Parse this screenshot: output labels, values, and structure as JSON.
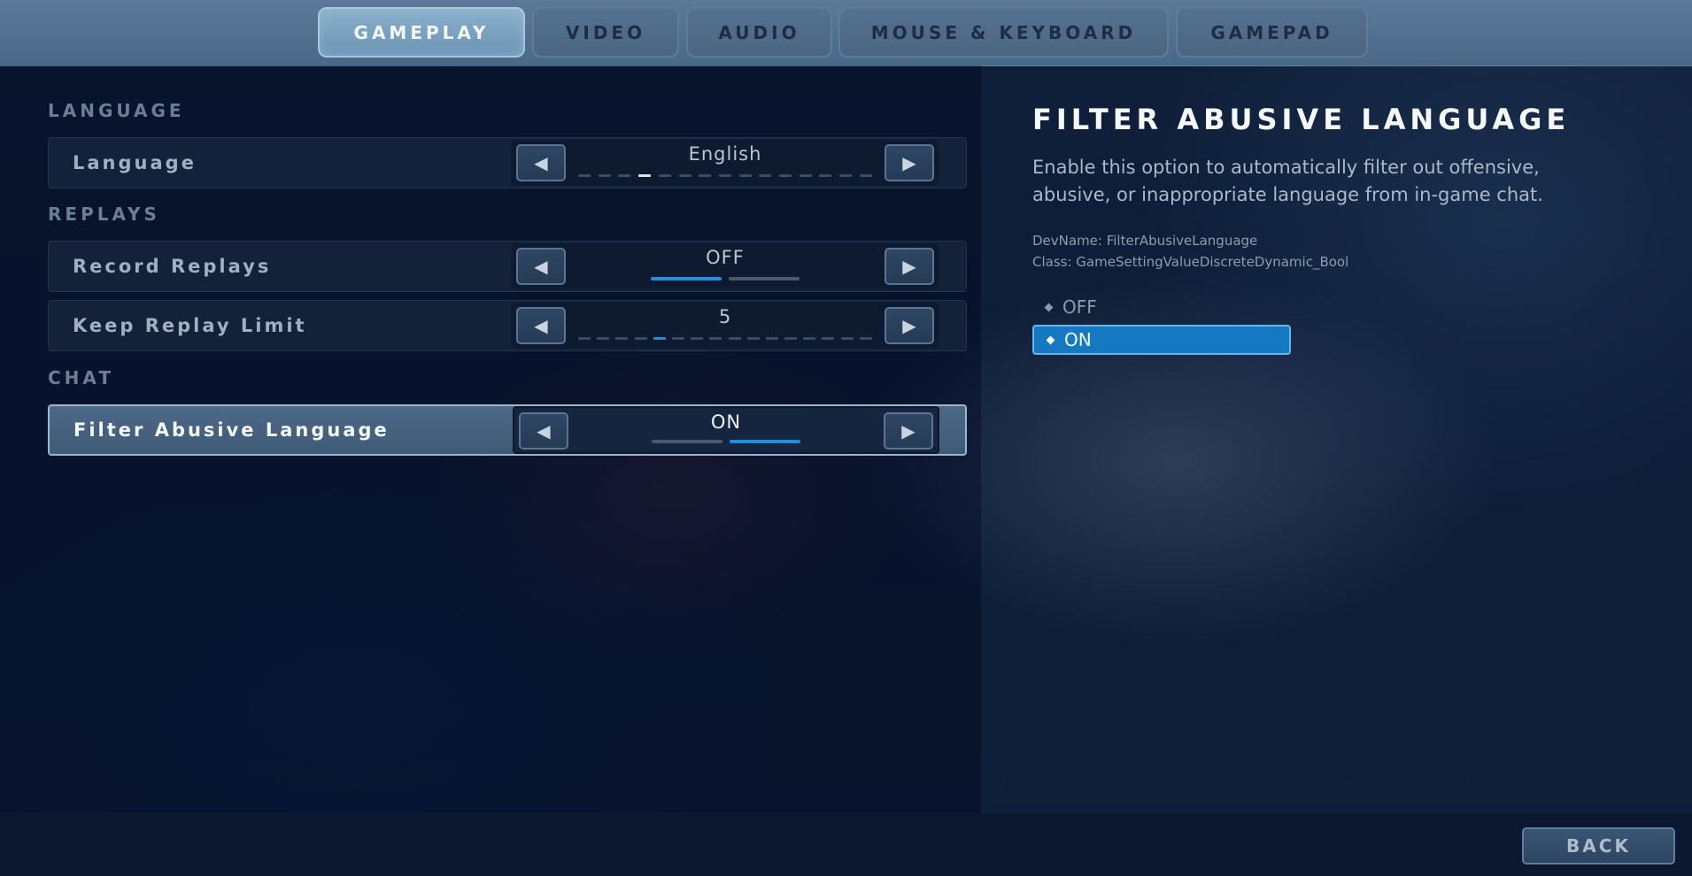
{
  "tabs": [
    {
      "label": "GAMEPLAY"
    },
    {
      "label": "VIDEO"
    },
    {
      "label": "AUDIO"
    },
    {
      "label": "MOUSE & KEYBOARD"
    },
    {
      "label": "GAMEPAD"
    }
  ],
  "sections": {
    "language": "LANGUAGE",
    "replays": "REPLAYS",
    "chat": "CHAT"
  },
  "settings": {
    "language": {
      "label": "Language",
      "value": "English",
      "index": 4,
      "count": 15
    },
    "record_replays": {
      "label": "Record Replays",
      "value": "OFF",
      "active_segment": 1,
      "segments": 2
    },
    "keep_replay_limit": {
      "label": "Keep Replay Limit",
      "value": "5",
      "index": 5,
      "count": 16
    },
    "filter_abusive_language": {
      "label": "Filter Abusive Language",
      "value": "ON",
      "active_segment": 2,
      "segments": 2
    }
  },
  "detail": {
    "title": "FILTER ABUSIVE LANGUAGE",
    "description": "Enable this option to automatically filter out offensive, abusive, or inappropriate language from in-game chat.",
    "devname": "DevName: FilterAbusiveLanguage",
    "class": "Class: GameSettingValueDiscreteDynamic_Bool",
    "options": [
      {
        "label": "OFF",
        "selected": false
      },
      {
        "label": "ON",
        "selected": true
      }
    ]
  },
  "footer": {
    "back_label": "BACK"
  },
  "colors": {
    "accent": "#1f8fe3",
    "selected_option": "#1578c2"
  },
  "icons": {
    "prev": "left-triangle-icon",
    "next": "right-triangle-icon"
  }
}
